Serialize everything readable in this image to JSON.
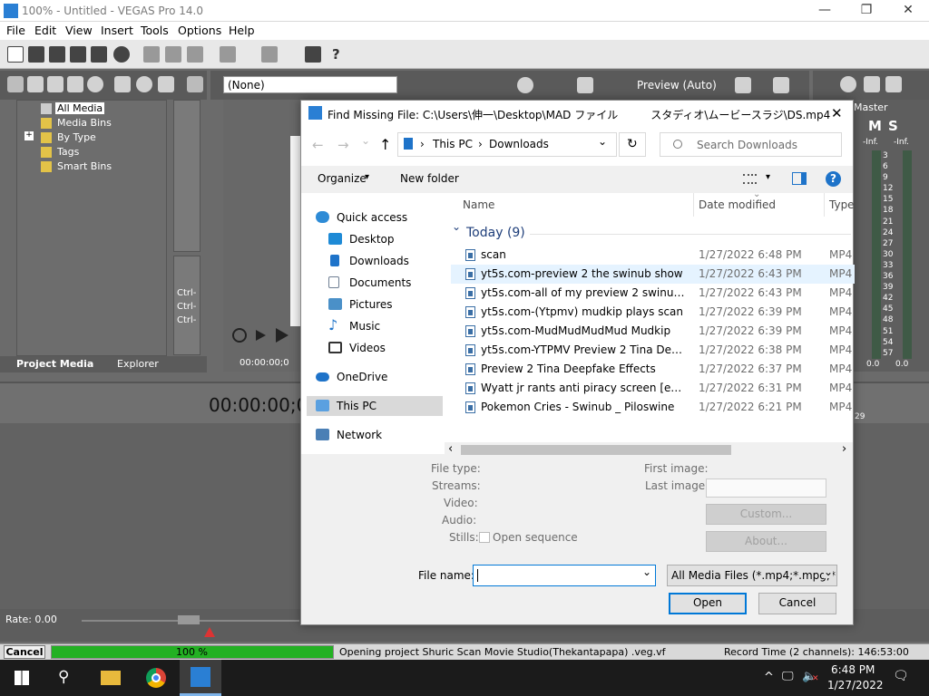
{
  "window": {
    "title": "100% - Untitled - VEGAS Pro 14.0",
    "minimize_glyph": "—",
    "restore_glyph": "❐",
    "close_glyph": "✕"
  },
  "menu": [
    "File",
    "Edit",
    "View",
    "Insert",
    "Tools",
    "Options",
    "Help"
  ],
  "vegas": {
    "preset_select": "(None)",
    "preview_quality": "Preview (Auto)",
    "master_label": "Master",
    "bins": [
      "All Media",
      "Media Bins",
      "By Type",
      "Tags",
      "Smart Bins"
    ],
    "tree_expand": "+",
    "tabs": [
      "Project Media",
      "Explorer"
    ],
    "timecode_small": "00:00:00;0",
    "timecode_large": "00:00:00;00",
    "ctrl_labels": [
      "Ctrl-",
      "Ctrl-",
      "Ctrl-"
    ],
    "meter_inf": [
      "-Inf.",
      "-Inf."
    ],
    "meter_ticks": [
      "3",
      "6",
      "9",
      "12",
      "15",
      "18",
      "21",
      "24",
      "27",
      "30",
      "33",
      "36",
      "39",
      "42",
      "45",
      "48",
      "51",
      "54",
      "57"
    ],
    "meter_bottom": [
      "0.0",
      "0.0"
    ],
    "ms_letters": [
      "M",
      "S"
    ],
    "ruler_mark": "29",
    "rate": "Rate: 0.00"
  },
  "status": {
    "cancel": "Cancel",
    "progress_label": "100 %",
    "progress_value": 1.0,
    "message": "Opening project Shuric Scan Movie Studio(Thekantapapa) .veg.vf",
    "record_time": "Record Time (2 channels): 146:53:00"
  },
  "dialog": {
    "title": "Find Missing File: C:\\Users\\伸一\\Desktop\\MAD ファイル　　　スタディオ\\ムービースラジ\\DS.mp4",
    "close_glyph": "✕",
    "back_glyph": "←",
    "forward_glyph": "→",
    "dropdown_glyph": "⌄",
    "up_glyph": "↑",
    "breadcrumb": [
      "This PC",
      "Downloads"
    ],
    "breadcrumb_sep": "›",
    "refresh_glyph": "↻",
    "search_placeholder": "Search Downloads",
    "organize": "Organize",
    "organize_caret": "▾",
    "new_folder": "New folder",
    "view_caret": "▾",
    "help_glyph": "?",
    "columns": {
      "name": "Name",
      "date": "Date modified",
      "type": "Type",
      "sort_caret": "⌄"
    },
    "group": "Today (9)",
    "group_chevron": "⌄",
    "files": [
      {
        "name": "scan",
        "date": "1/27/2022 6:48 PM",
        "type": "MP4"
      },
      {
        "name": "yt5s.com-preview 2 the swinub show",
        "date": "1/27/2022 6:43 PM",
        "type": "MP4"
      },
      {
        "name": "yt5s.com-all of my preview 2 swinub deepfakes",
        "date": "1/27/2022 6:43 PM",
        "type": "MP4"
      },
      {
        "name": "yt5s.com-(Ytpmv) mudkip plays scan",
        "date": "1/27/2022 6:39 PM",
        "type": "MP4"
      },
      {
        "name": "yt5s.com-MudMudMudMud Mudkip",
        "date": "1/27/2022 6:39 PM",
        "type": "MP4"
      },
      {
        "name": "yt5s.com-YTPMV Preview 2 Tina Deepfakes",
        "date": "1/27/2022 6:38 PM",
        "type": "MP4"
      },
      {
        "name": "Preview 2 Tina Deepfake Effects",
        "date": "1/27/2022 6:37 PM",
        "type": "MP4"
      },
      {
        "name": "Wyatt jr rants anti piracy screen [exe]",
        "date": "1/27/2022 6:31 PM",
        "type": "MP4"
      },
      {
        "name": "Pokemon Cries - Swinub _ Piloswine",
        "date": "1/27/2022 6:21 PM",
        "type": "MP4"
      }
    ],
    "nav": {
      "quick_access": "Quick access",
      "pinned": [
        {
          "label": "Desktop",
          "color": "#1e8ad6"
        },
        {
          "label": "Downloads",
          "color": "#1e73c9"
        },
        {
          "label": "Documents",
          "color": "#6f7f93"
        },
        {
          "label": "Pictures",
          "color": "#4a90c8"
        }
      ],
      "pin_glyph": "📌",
      "music": "Music",
      "videos": "Videos",
      "onedrive": "OneDrive",
      "this_pc": "This PC",
      "network": "Network",
      "music_glyph": "♪"
    },
    "scroll_left": "‹",
    "scroll_right": "›",
    "info_labels": [
      "File type:",
      "Streams:",
      "Video:",
      "Audio:",
      "Stills:"
    ],
    "first_image": "First image:",
    "last_image": "Last image:",
    "open_sequence": "Open sequence",
    "custom_btn": "Custom...",
    "about_btn": "About...",
    "file_name_label": "File name:",
    "file_name_value": "",
    "filter": "All Media Files (*.mp4;*.mpg;*.j",
    "open_btn": "Open",
    "cancel_btn": "Cancel"
  },
  "taskbar": {
    "time": "6:48 PM",
    "date": "1/27/2022",
    "caret_up": "^",
    "search_glyph": "⚲",
    "network_glyph": "🖵",
    "volume_glyph": "🔈",
    "mute_glyph": "✕",
    "notifications_glyph": "🗨"
  }
}
